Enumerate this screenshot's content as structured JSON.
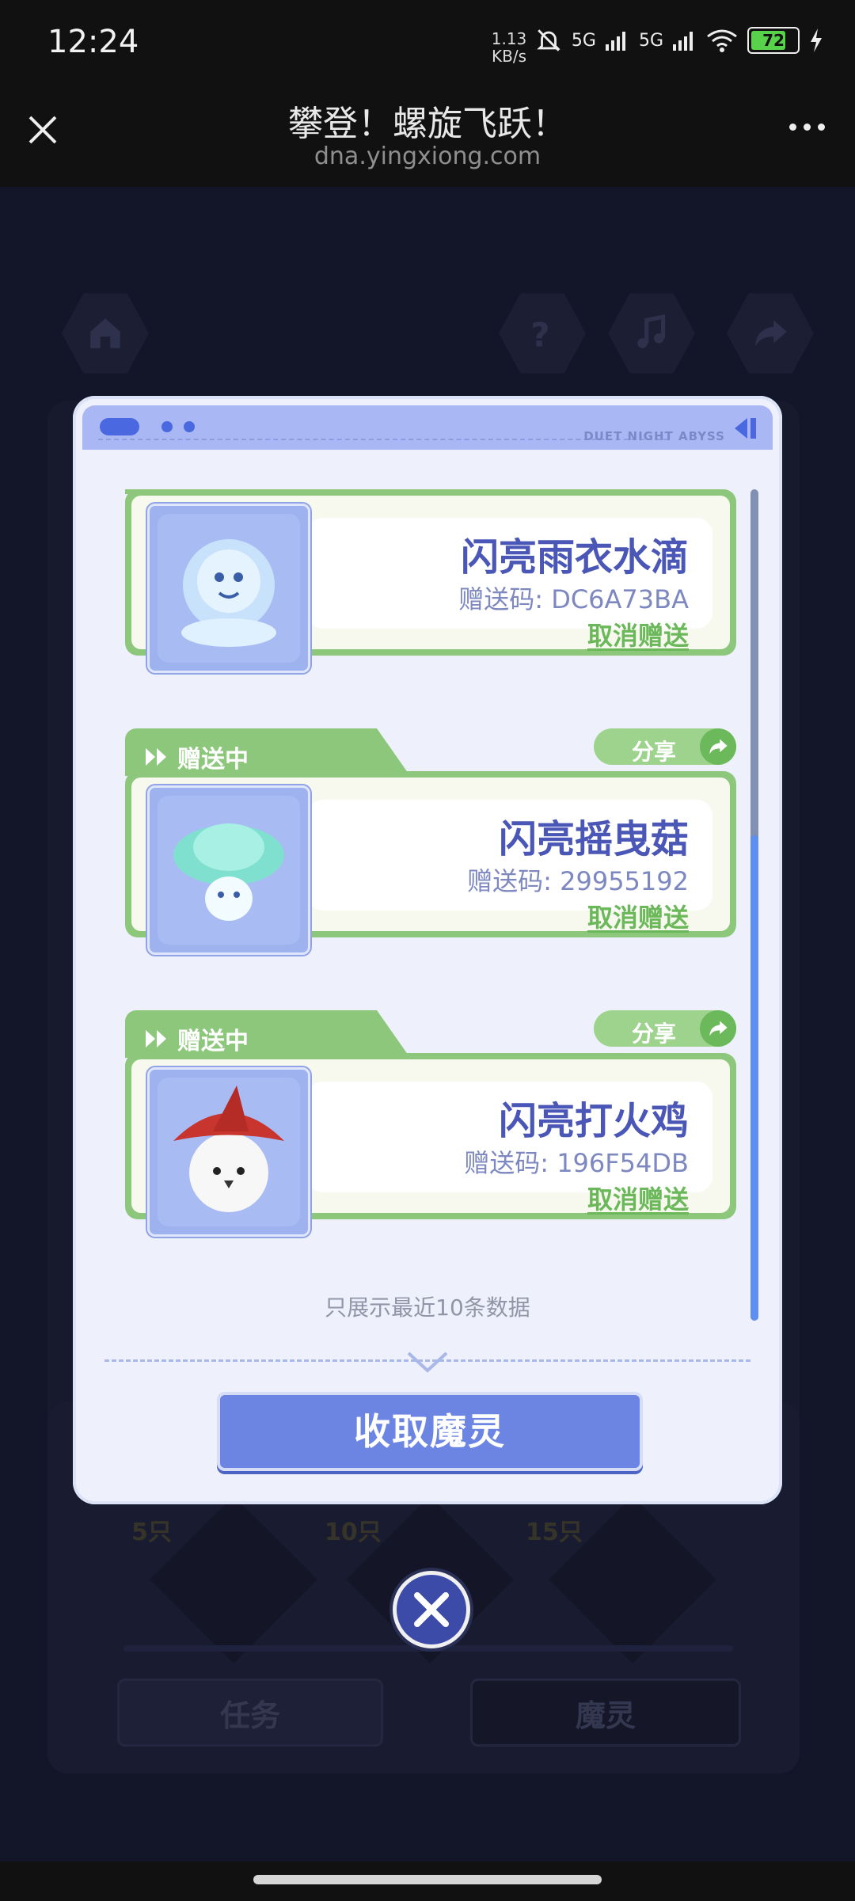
{
  "status_bar": {
    "time": "12:24",
    "net_speed": "1.13 KB/s",
    "battery": "72",
    "signal_1": "5G",
    "signal_2": "5G"
  },
  "browser": {
    "title": "攀登！螺旋飞跃！",
    "url": "dna.yingxiong.com"
  },
  "modal": {
    "brand": "DUET NIGHT ABYSS",
    "gifts": [
      {
        "status": "",
        "share_label": "",
        "name": "闪亮雨衣水滴",
        "code": "赠送码: DC6A73BA",
        "cancel_label": "取消赠送"
      },
      {
        "status": "赠送中",
        "share_label": "分享",
        "name": "闪亮摇曳菇",
        "code": "赠送码: 29955192",
        "cancel_label": "取消赠送"
      },
      {
        "status": "赠送中",
        "share_label": "分享",
        "name": "闪亮打火鸡",
        "code": "赠送码: 196F54DB",
        "cancel_label": "取消赠送"
      }
    ],
    "note": "只展示最近10条数据",
    "collect_label": "收取魔灵"
  },
  "background": {
    "badges": [
      "5只",
      "10只",
      "15只"
    ],
    "tabs": [
      "任务",
      "魔灵"
    ]
  },
  "colors": {
    "accent": "#6c84e2",
    "card_green": "#8dc77c",
    "name_blue": "#4b57b6"
  }
}
